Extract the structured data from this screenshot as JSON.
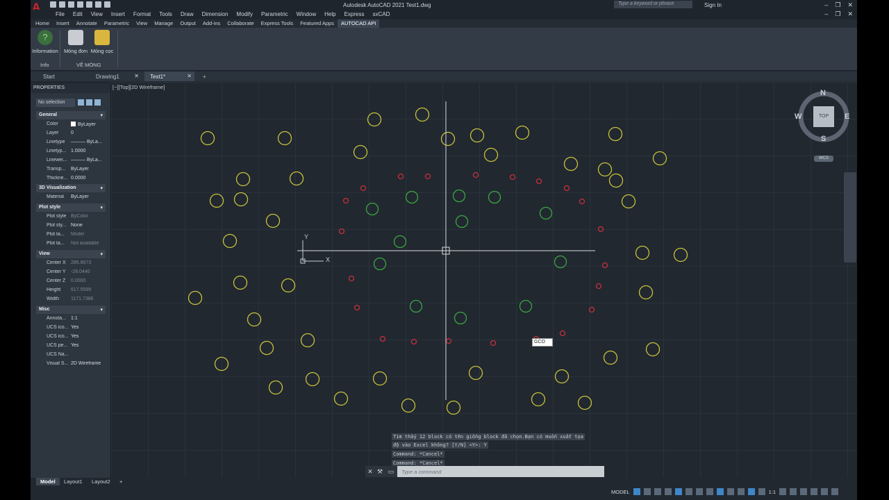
{
  "app": {
    "window_title": "Autodesk AutoCAD 2021    Test1.dwg",
    "search_placeholder": "Type a keyword or phrase",
    "sign_in": "Sign In"
  },
  "menu": [
    "File",
    "Edit",
    "View",
    "Insert",
    "Format",
    "Tools",
    "Draw",
    "Dimension",
    "Modify",
    "Parametric",
    "Window",
    "Help",
    "Express",
    "sxCAD"
  ],
  "ribbon_tabs": [
    {
      "label": "Home"
    },
    {
      "label": "Insert"
    },
    {
      "label": "Annotate"
    },
    {
      "label": "Parametric"
    },
    {
      "label": "View"
    },
    {
      "label": "Manage"
    },
    {
      "label": "Output"
    },
    {
      "label": "Add-ins"
    },
    {
      "label": "Collaborate"
    },
    {
      "label": "Express Tools"
    },
    {
      "label": "Featured Apps"
    },
    {
      "label": "AUTOCAD API",
      "active": true
    }
  ],
  "ribbon": {
    "information": "Information",
    "mong_don": "Móng đơn",
    "mong_coc": "Móng cọc",
    "panel_info": "Info",
    "panel_ve_mong": "VẼ MÓNG"
  },
  "doc_tabs": {
    "start": "Start",
    "drawing1": "Drawing1",
    "test1": "Test1*",
    "add": "+"
  },
  "properties": {
    "title": "PROPERTIES",
    "selection": "No selection",
    "general": {
      "header": "General",
      "rows": [
        {
          "k": "Color",
          "v": "ByLayer"
        },
        {
          "k": "Layer",
          "v": "0"
        },
        {
          "k": "Linetype",
          "v": "——— ByLa..."
        },
        {
          "k": "Linetyp...",
          "v": "1.0000"
        },
        {
          "k": "Linewei...",
          "v": "——— ByLa..."
        },
        {
          "k": "Transp...",
          "v": "ByLayer"
        },
        {
          "k": "Thickne...",
          "v": "0.0000"
        }
      ]
    },
    "viz": {
      "header": "3D Visualization",
      "rows": [
        {
          "k": "Material",
          "v": "ByLayer"
        }
      ]
    },
    "plot": {
      "header": "Plot style",
      "rows": [
        {
          "k": "Plot style",
          "v": "ByColor"
        },
        {
          "k": "Plot sty...",
          "v": "None"
        },
        {
          "k": "Plot ta...",
          "v": "Model"
        },
        {
          "k": "Plot ta...",
          "v": "Not available"
        }
      ]
    },
    "view": {
      "header": "View",
      "rows": [
        {
          "k": "Center X",
          "v": "285.8673"
        },
        {
          "k": "Center Y",
          "v": "-28.0440"
        },
        {
          "k": "Center Z",
          "v": "0.0000"
        },
        {
          "k": "Height",
          "v": "617.5599"
        },
        {
          "k": "Width",
          "v": "1171.7386"
        }
      ]
    },
    "misc": {
      "header": "Misc",
      "rows": [
        {
          "k": "Annota...",
          "v": "1:1"
        },
        {
          "k": "UCS ico...",
          "v": "Yes"
        },
        {
          "k": "UCS ico...",
          "v": "Yes"
        },
        {
          "k": "UCS pe...",
          "v": "Yes"
        },
        {
          "k": "UCS Na...",
          "v": ""
        },
        {
          "k": "Visual S...",
          "v": "2D Wireframe"
        }
      ]
    }
  },
  "viewport": {
    "label": "[−][Top][2D Wireframe]",
    "dynamic_input": "GCO",
    "ucs_y": "Y",
    "ucs_x": "X"
  },
  "viewcube": {
    "n": "N",
    "s": "S",
    "e": "E",
    "w": "W",
    "top": "TOP",
    "wcs": "WCS"
  },
  "command": {
    "history": [
      "Tìm thấy 12 block có tên giống block đã chọn.Bạn có muốn xuất tọa",
      "độ vào Excel không? [Y/N] <Y>: Y",
      "Command: *Cancel*",
      "Command: *Cancel*"
    ],
    "placeholder": "Type a command"
  },
  "layout_tabs": {
    "model": "Model",
    "layout1": "Layout1",
    "layout2": "Layout2",
    "add": "+"
  },
  "status": {
    "model": "MODEL",
    "scale": "1:1"
  },
  "colors": {
    "yellow": "#c8c23a",
    "green": "#3aa640",
    "red": "#c8303a",
    "crosshair": "#d7dce0"
  }
}
